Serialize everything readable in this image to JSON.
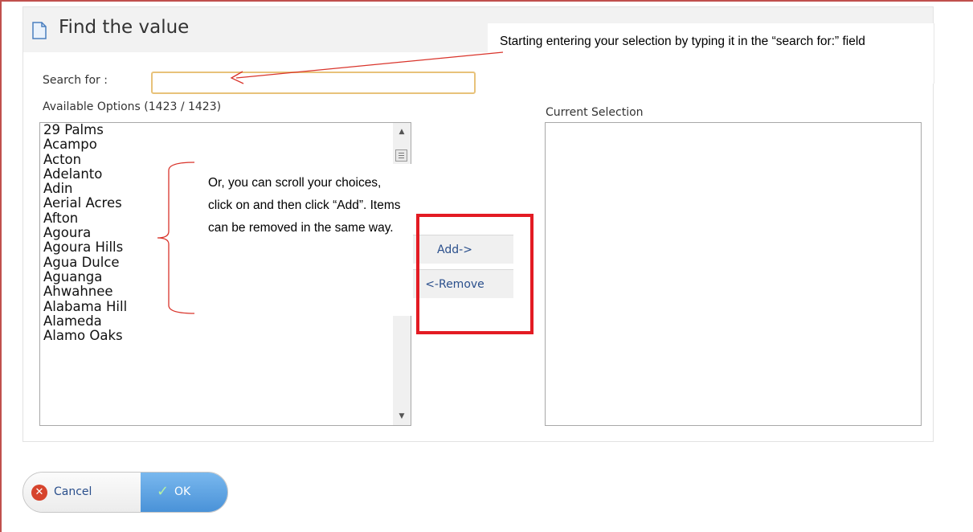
{
  "dialog": {
    "title": "Find the value",
    "search_label": "Search for :",
    "search_value": "",
    "available_label": "Available Options (1423 / 1423)",
    "current_label": "Current Selection"
  },
  "available_options": [
    "29 Palms",
    "Acampo",
    "Acton",
    "Adelanto",
    "Adin",
    "Aerial Acres",
    "Afton",
    "Agoura",
    "Agoura Hills",
    "Agua Dulce",
    "Aguanga",
    "Ahwahnee",
    "Alabama Hill",
    "Alameda",
    "Alamo Oaks"
  ],
  "current_selection": [],
  "buttons": {
    "add": "Add->",
    "remove": "<-Remove",
    "cancel": "Cancel",
    "ok": "OK"
  },
  "annotations": {
    "top_callout": "Starting entering your selection by typing it in the “search for:” field",
    "middle_callout": "Or, you can scroll your choices, click on and then click “Add”. Items can be removed in the same way."
  },
  "colors": {
    "annotation_red": "#e31b23",
    "search_border": "#e8c27a",
    "ok_blue": "#4a92d8",
    "cancel_red": "#d6442d"
  },
  "icons": {
    "title_icon": "document-icon",
    "cancel_icon": "cancel-x-icon",
    "ok_icon": "checkmark-icon",
    "scroll_up": "arrow-up-icon",
    "scroll_down": "arrow-down-icon"
  }
}
